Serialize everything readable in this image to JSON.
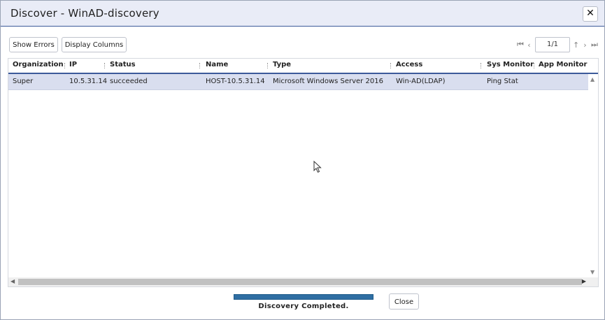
{
  "dialog": {
    "title": "Discover - WinAD-discovery",
    "close_icon": "close-icon"
  },
  "toolbar": {
    "show_errors_label": "Show Errors",
    "display_columns_label": "Display Columns",
    "display_columns_caret": "▾"
  },
  "pager": {
    "first_icon": "first-page-icon",
    "prev_icon": "prev-page-icon",
    "page_value": "1/1",
    "refresh_icon": "refresh-icon",
    "next_icon": "next-page-icon",
    "last_icon": "last-page-icon"
  },
  "grid": {
    "columns": [
      "Organization",
      "IP",
      "Status",
      "Name",
      "Type",
      "Access",
      "Sys Monitor",
      "App Monitor"
    ],
    "rows": [
      {
        "organization": "Super",
        "ip": "10.5.31.14",
        "status": "succeeded",
        "name": "HOST-10.5.31.14",
        "type": "Microsoft Windows Server 2016",
        "access": "Win-AD(LDAP)",
        "sys_monitor": "Ping Stat",
        "app_monitor": ""
      }
    ]
  },
  "progress": {
    "value_percent": 100,
    "status_text": "Discovery Completed.",
    "color": "#2f6ea3"
  },
  "footer": {
    "close_label": "Close"
  },
  "colors": {
    "accent": "#3c5a9a",
    "selected_row": "#d9deef",
    "titlebar": "#e9ecf7"
  }
}
